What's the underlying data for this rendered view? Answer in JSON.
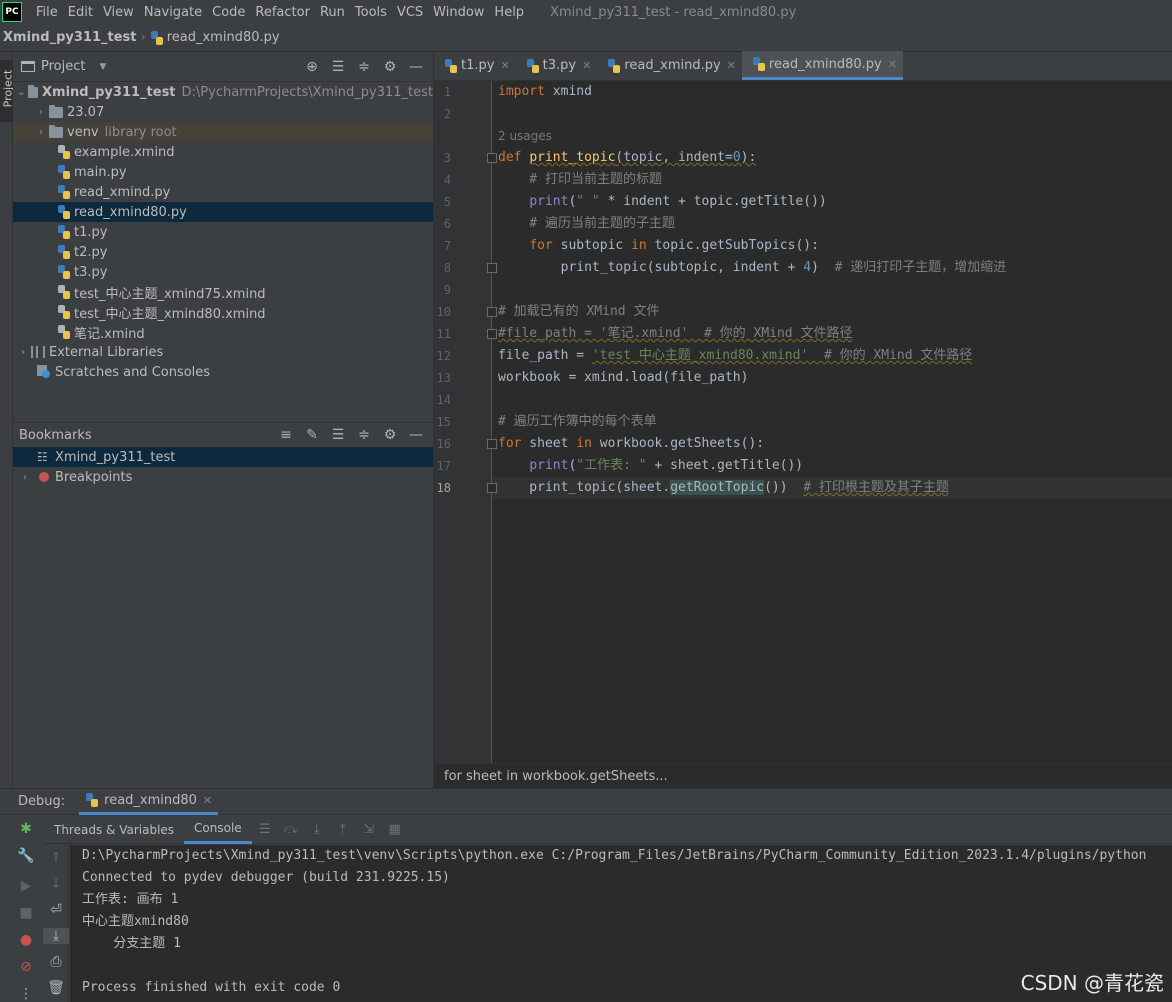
{
  "menubar": {
    "logo": "PC",
    "items": [
      "File",
      "Edit",
      "View",
      "Navigate",
      "Code",
      "Refactor",
      "Run",
      "Tools",
      "VCS",
      "Window",
      "Help"
    ],
    "window_title": "Xmind_py311_test - read_xmind80.py"
  },
  "navbar": {
    "project": "Xmind_py311_test",
    "file": "read_xmind80.py"
  },
  "left_stripe": {
    "project_label": "Project"
  },
  "project_panel": {
    "title": "Project",
    "root": {
      "name": "Xmind_py311_test",
      "path": "D:\\PycharmProjects\\Xmind_py311_test"
    },
    "items": [
      {
        "name": "23.07",
        "hint": ""
      },
      {
        "name": "venv",
        "hint": "library root"
      },
      {
        "name": "example.xmind"
      },
      {
        "name": "main.py"
      },
      {
        "name": "read_xmind.py"
      },
      {
        "name": "read_xmind80.py"
      },
      {
        "name": "t1.py"
      },
      {
        "name": "t2.py"
      },
      {
        "name": "t3.py"
      },
      {
        "name": "test_中心主题_xmind75.xmind"
      },
      {
        "name": "test_中心主题_xmind80.xmind"
      },
      {
        "name": "笔记.xmind"
      }
    ],
    "external_libraries": "External Libraries",
    "scratches": "Scratches and Consoles"
  },
  "bookmarks_panel": {
    "title": "Bookmarks",
    "items": [
      "Xmind_py311_test",
      "Breakpoints"
    ]
  },
  "editor": {
    "tabs": [
      "t1.py",
      "t3.py",
      "read_xmind.py",
      "read_xmind80.py"
    ],
    "active_tab": "read_xmind80.py",
    "line_numbers": [
      "1",
      "2",
      "3",
      "4",
      "5",
      "6",
      "7",
      "8",
      "9",
      "10",
      "11",
      "12",
      "13",
      "14",
      "15",
      "16",
      "17",
      "18"
    ],
    "usages_hint": "2 usages",
    "breadcrumb": "for sheet in workbook.getSheets...",
    "code": {
      "l1_kw": "import",
      "l1_rest": " xmind",
      "l3_kw": "def",
      "l3_fn": "print_topic",
      "l3_params": "(topic, indent=",
      "l3_num": "0",
      "l3_end": "):",
      "l4": "    # 打印当前主题的标题",
      "l5_builtin": "print",
      "l5_a": "(",
      "l5_str": "\" \"",
      "l5_b": " * indent + topic.getTitle())",
      "l6": "    # 遍历当前主题的子主题",
      "l7_kw1": "for",
      "l7_a": " subtopic ",
      "l7_kw2": "in",
      "l7_b": " topic.getSubTopics():",
      "l8_a": "        print_topic(subtopic, indent + ",
      "l8_num": "4",
      "l8_b": ")  ",
      "l8_cm": "# 递归打印子主题，增加缩进",
      "l10": "# 加载已有的 XMind 文件",
      "l11": "#file_path = '笔记.xmind'  # 你的 XMind 文件路径",
      "l12_a": "file_path = ",
      "l12_str": "'test_中心主题_xmind80.xmind'",
      "l12_cm": "  # 你的 XMind 文件路径",
      "l13": "workbook = xmind.load(file_path)",
      "l15": "# 遍历工作簿中的每个表单",
      "l16_kw1": "for",
      "l16_a": " sheet ",
      "l16_kw2": "in",
      "l16_b": " workbook.getSheets():",
      "l17_builtin": "print",
      "l17_a": "(",
      "l17_str": "\"工作表: \"",
      "l17_b": " + sheet.getTitle())",
      "l18_a": "    print_topic(sheet.",
      "l18_b": "getRootTopic",
      "l18_c": "())  ",
      "l18_cm": "# 打印根主题及其子主题"
    }
  },
  "debug": {
    "label": "Debug:",
    "session_tab": "read_xmind80",
    "subtabs": [
      "Threads & Variables",
      "Console"
    ],
    "console_lines": [
      "D:\\PycharmProjects\\Xmind_py311_test\\venv\\Scripts\\python.exe C:/Program_Files/JetBrains/PyCharm_Community_Edition_2023.1.4/plugins/python",
      "Connected to pydev debugger (build 231.9225.15)",
      "工作表: 画布 1",
      "中心主题xmind80",
      "    分支主题 1",
      "",
      "Process finished with exit code 0"
    ]
  },
  "watermark": "CSDN @青花瓷"
}
